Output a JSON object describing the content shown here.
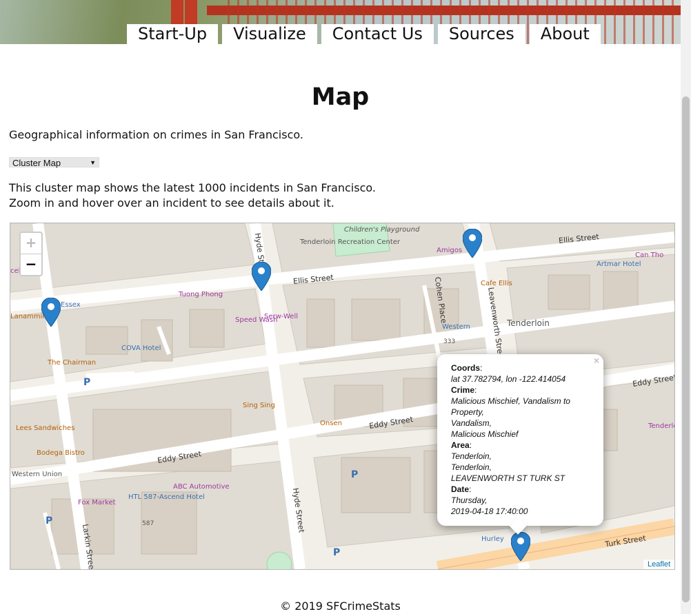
{
  "nav": {
    "items": [
      "Start-Up",
      "Visualize",
      "Contact Us",
      "Sources",
      "About"
    ]
  },
  "page": {
    "title": "Map",
    "intro": "Geographical information on crimes in San Francisco.",
    "select_value": "Cluster Map",
    "desc_line1": "This cluster map shows the latest 1000 incidents in San Francisco.",
    "desc_line2": "Zoom in and hover over an incident to see details about it."
  },
  "map": {
    "zoom_in": "+",
    "zoom_out": "−",
    "attribution": "Leaflet",
    "streets": [
      "Ellis Street",
      "Ellis Street",
      "Eddy Street",
      "Eddy Street",
      "Eddy Street",
      "Turk Street",
      "Hyde Street",
      "Hyde Street",
      "Leavenworth Street",
      "Larkin Street",
      "Cohen Place"
    ],
    "pois": [
      "Tenderloin Recreation Center",
      "Children's Playground",
      "Amigos",
      "Can Tho",
      "Artmar Hotel",
      "Cafe Ellis",
      "Tenderloin",
      "Western",
      "333",
      "Tuong Phong",
      "Speed Wash",
      "Serw-Well",
      "Essex",
      "COVA Hotel",
      "The Chairman",
      "Sing Sing",
      "Onsen",
      "Lees Sandwiches",
      "Bodega Bistro",
      "Western Union",
      "Fox Market",
      "HTL 587-Ascend Hotel",
      "587",
      "ABC Automotive",
      "Hurley",
      "Tenderloin Police Station",
      "Lanammin",
      "celbil"
    ],
    "popup": {
      "close": "×",
      "coords_label": "Coords",
      "coords_value": "lat 37.782794, lon -122.414054",
      "crime_label": "Crime",
      "crime_line1": "Malicious Mischief, Vandalism to Property,",
      "crime_line2": "Vandalism,",
      "crime_line3": "Malicious Mischief",
      "area_label": "Area",
      "area_line1": "Tenderloin,",
      "area_line2": "Tenderloin,",
      "area_line3": "LEAVENWORTH ST TURK ST",
      "date_label": "Date",
      "date_line1": "Thursday,",
      "date_line2": "2019-04-18 17:40:00"
    }
  },
  "footer": "© 2019 SFCrimeStats"
}
